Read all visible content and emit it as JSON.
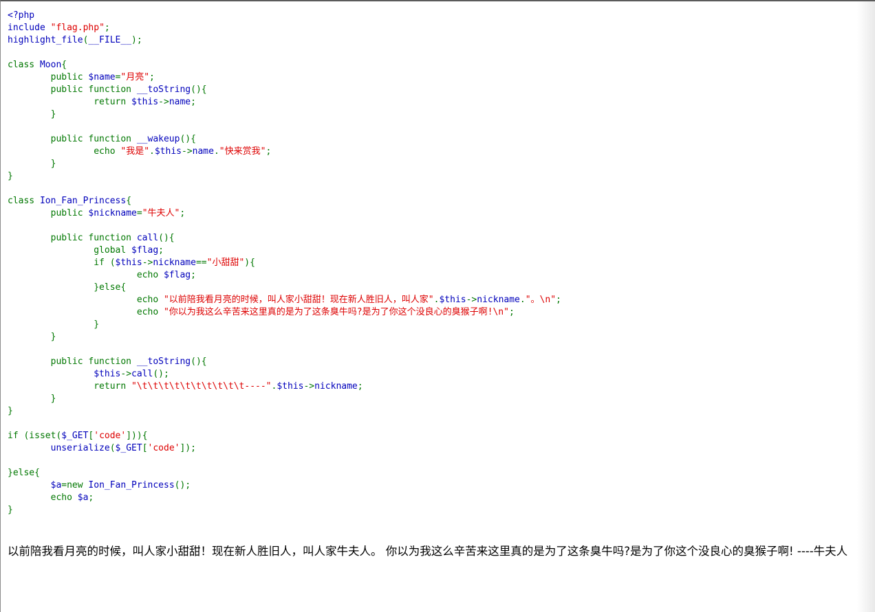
{
  "source": {
    "lines": [
      [
        [
          "t",
          "<?php"
        ]
      ],
      [
        [
          "t",
          "include "
        ],
        [
          "s",
          "\"flag.php\""
        ],
        [
          "k",
          ";"
        ]
      ],
      [
        [
          "t",
          "highlight_file"
        ],
        [
          "k",
          "("
        ],
        [
          "t",
          "__FILE__"
        ],
        [
          "k",
          ");"
        ]
      ],
      [],
      [
        [
          "k",
          "class "
        ],
        [
          "t",
          "Moon"
        ],
        [
          "k",
          "{"
        ]
      ],
      [
        [
          "k",
          "        public "
        ],
        [
          "t",
          "$name"
        ],
        [
          "k",
          "="
        ],
        [
          "s",
          "\"月亮\""
        ],
        [
          "k",
          ";"
        ]
      ],
      [
        [
          "k",
          "        public function "
        ],
        [
          "t",
          "__toString"
        ],
        [
          "k",
          "(){"
        ]
      ],
      [
        [
          "k",
          "                return "
        ],
        [
          "t",
          "$this"
        ],
        [
          "k",
          "->"
        ],
        [
          "t",
          "name"
        ],
        [
          "k",
          ";"
        ]
      ],
      [
        [
          "k",
          "        }"
        ]
      ],
      [],
      [
        [
          "k",
          "        public function "
        ],
        [
          "t",
          "__wakeup"
        ],
        [
          "k",
          "(){"
        ]
      ],
      [
        [
          "k",
          "                echo "
        ],
        [
          "s",
          "\"我是\""
        ],
        [
          "k",
          "."
        ],
        [
          "t",
          "$this"
        ],
        [
          "k",
          "->"
        ],
        [
          "t",
          "name"
        ],
        [
          "k",
          "."
        ],
        [
          "s",
          "\"快来赏我\""
        ],
        [
          "k",
          ";"
        ]
      ],
      [
        [
          "k",
          "        }"
        ]
      ],
      [
        [
          "k",
          "}"
        ]
      ],
      [],
      [
        [
          "k",
          "class "
        ],
        [
          "t",
          "Ion_Fan_Princess"
        ],
        [
          "k",
          "{"
        ]
      ],
      [
        [
          "k",
          "        public "
        ],
        [
          "t",
          "$nickname"
        ],
        [
          "k",
          "="
        ],
        [
          "s",
          "\"牛夫人\""
        ],
        [
          "k",
          ";"
        ]
      ],
      [],
      [
        [
          "k",
          "        public function "
        ],
        [
          "t",
          "call"
        ],
        [
          "k",
          "(){"
        ]
      ],
      [
        [
          "k",
          "                global "
        ],
        [
          "t",
          "$flag"
        ],
        [
          "k",
          ";"
        ]
      ],
      [
        [
          "k",
          "                if ("
        ],
        [
          "t",
          "$this"
        ],
        [
          "k",
          "->"
        ],
        [
          "t",
          "nickname"
        ],
        [
          "k",
          "=="
        ],
        [
          "s",
          "\"小甜甜\""
        ],
        [
          "k",
          "){"
        ]
      ],
      [
        [
          "k",
          "                        echo "
        ],
        [
          "t",
          "$flag"
        ],
        [
          "k",
          ";"
        ]
      ],
      [
        [
          "k",
          "                }else{"
        ]
      ],
      [
        [
          "k",
          "                        echo "
        ],
        [
          "s",
          "\"以前陪我看月亮的时候，叫人家小甜甜！现在新人胜旧人，叫人家\""
        ],
        [
          "k",
          "."
        ],
        [
          "t",
          "$this"
        ],
        [
          "k",
          "->"
        ],
        [
          "t",
          "nickname"
        ],
        [
          "k",
          "."
        ],
        [
          "s",
          "\"。\\n\""
        ],
        [
          "k",
          ";"
        ]
      ],
      [
        [
          "k",
          "                        echo "
        ],
        [
          "s",
          "\"你以为我这么辛苦来这里真的是为了这条臭牛吗?是为了你这个没良心的臭猴子啊!\\n\""
        ],
        [
          "k",
          ";"
        ]
      ],
      [
        [
          "k",
          "                }"
        ]
      ],
      [
        [
          "k",
          "        }"
        ]
      ],
      [],
      [
        [
          "k",
          "        public function "
        ],
        [
          "t",
          "__toString"
        ],
        [
          "k",
          "(){"
        ]
      ],
      [
        [
          "t",
          "                $this"
        ],
        [
          "k",
          "->"
        ],
        [
          "t",
          "call"
        ],
        [
          "k",
          "();"
        ]
      ],
      [
        [
          "k",
          "                return "
        ],
        [
          "s",
          "\"\\t\\t\\t\\t\\t\\t\\t\\t\\t\\t----\""
        ],
        [
          "k",
          "."
        ],
        [
          "t",
          "$this"
        ],
        [
          "k",
          "->"
        ],
        [
          "t",
          "nickname"
        ],
        [
          "k",
          ";"
        ]
      ],
      [
        [
          "k",
          "        }"
        ]
      ],
      [
        [
          "k",
          "}"
        ]
      ],
      [],
      [
        [
          "k",
          "if (isset("
        ],
        [
          "t",
          "$_GET"
        ],
        [
          "k",
          "["
        ],
        [
          "s",
          "'code'"
        ],
        [
          "k",
          "])){"
        ]
      ],
      [
        [
          "t",
          "        unserialize"
        ],
        [
          "k",
          "("
        ],
        [
          "t",
          "$_GET"
        ],
        [
          "k",
          "["
        ],
        [
          "s",
          "'code'"
        ],
        [
          "k",
          "]);"
        ]
      ],
      [],
      [
        [
          "k",
          "}else{"
        ]
      ],
      [
        [
          "t",
          "        $a"
        ],
        [
          "k",
          "=new "
        ],
        [
          "t",
          "Ion_Fan_Princess"
        ],
        [
          "k",
          "();"
        ]
      ],
      [
        [
          "k",
          "        echo "
        ],
        [
          "t",
          "$a"
        ],
        [
          "k",
          ";"
        ]
      ],
      [
        [
          "k",
          "}"
        ]
      ]
    ]
  },
  "output": {
    "text": "以前陪我看月亮的时候，叫人家小甜甜！现在新人胜旧人，叫人家牛夫人。 你以为我这么辛苦来这里真的是为了这条臭牛吗?是为了你这个没良心的臭猴子啊! ----牛夫人"
  },
  "colors": {
    "html_token": "#0000bb",
    "keyword": "#007700",
    "string": "#dd0000",
    "output_text": "#000000",
    "background": "#ffffff"
  }
}
